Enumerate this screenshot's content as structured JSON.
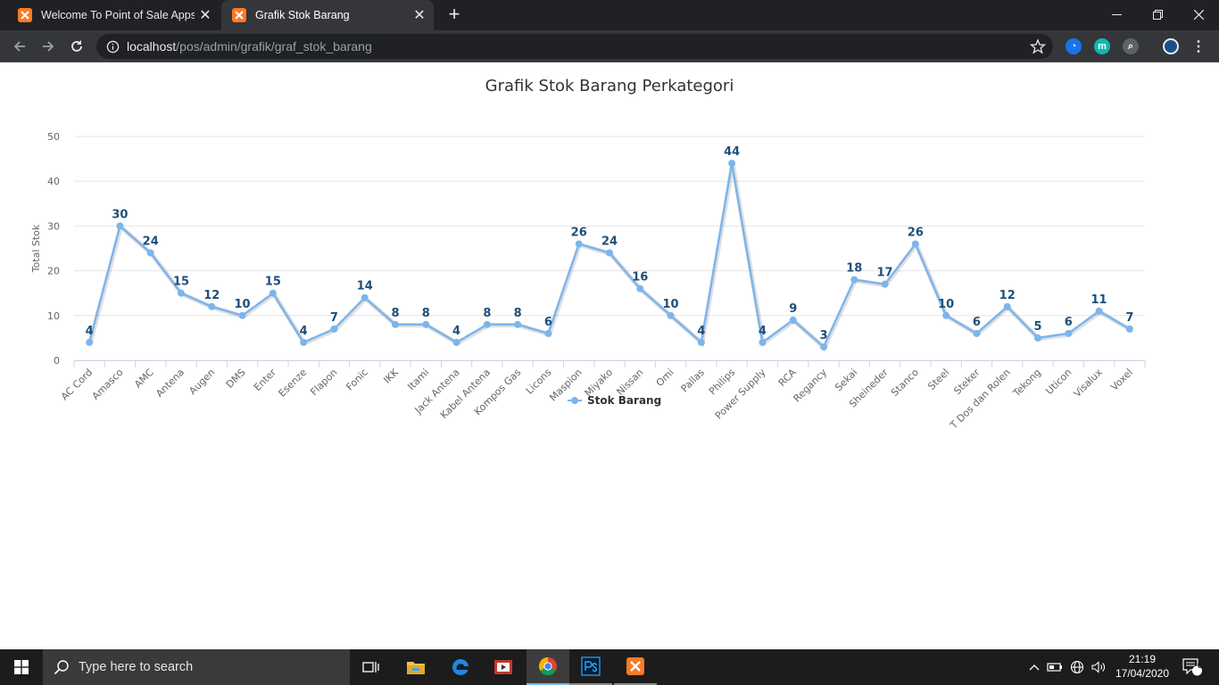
{
  "browser": {
    "tabs": [
      {
        "title": "Welcome To Point of Sale Apps"
      },
      {
        "title": "Grafik Stok Barang"
      }
    ],
    "url": {
      "host": "localhost",
      "path": "/pos/admin/grafik/graf_stok_barang"
    }
  },
  "chart_data": {
    "type": "line",
    "title": "Grafik Stok Barang Perkategori",
    "ylabel": "Total Stok",
    "xlabel": "",
    "ylim": [
      0,
      50
    ],
    "yticks": [
      0,
      10,
      20,
      30,
      40,
      50
    ],
    "grid": true,
    "legend_position": "bottom-center",
    "color": "#7cb5ec",
    "label_color": "#1f4e79",
    "categories": [
      "AC Cord",
      "Amasco",
      "AMC",
      "Antena",
      "Augen",
      "DMS",
      "Enter",
      "Esenze",
      "Flapon",
      "Fonic",
      "IKK",
      "Itami",
      "Jack Antena",
      "Kabel Antena",
      "Kompos Gas",
      "Licons",
      "Maspion",
      "Miyako",
      "Nissan",
      "Omi",
      "Pallas",
      "Philips",
      "Power Supply",
      "RCA",
      "Regancy",
      "Sekai",
      "Sheineder",
      "Stanco",
      "Steel",
      "Steker",
      "T Dos dan Rolen",
      "Tekong",
      "Uticon",
      "Visalux",
      "Voxel"
    ],
    "series": [
      {
        "name": "Stok Barang",
        "values": [
          4,
          30,
          24,
          15,
          12,
          10,
          15,
          4,
          7,
          14,
          8,
          8,
          4,
          8,
          8,
          6,
          26,
          24,
          16,
          10,
          4,
          44,
          4,
          9,
          3,
          18,
          17,
          26,
          10,
          6,
          12,
          5,
          6,
          11,
          7
        ]
      }
    ]
  },
  "taskbar": {
    "search_placeholder": "Type here to search",
    "time": "21:19",
    "date": "17/04/2020",
    "notification_count": "6"
  }
}
